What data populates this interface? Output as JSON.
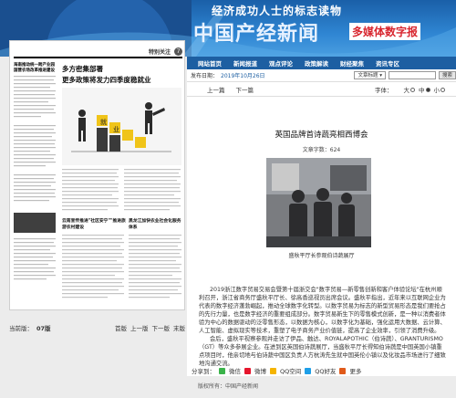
{
  "banner": {
    "slogan": "经济成功人士的标志读物",
    "brand": "中国产经新闻",
    "brand_sub": "多媒体数字报"
  },
  "nav": [
    "网站首页",
    "新闻报道",
    "观点评论",
    "政策解读",
    "财经聚焦",
    "资讯专区"
  ],
  "left_page": {
    "section": "特别关注",
    "page_no": "7",
    "headline_1": "多方密集部署",
    "headline_2": "更多政策将发力四季度稳就业",
    "side_title": "海南推动统一跨产业园国营农场改革推进建设",
    "sub_head_1": "云南宣传推进\"社区安宁\"\"推进旅游农村建设",
    "sub_head_2": "黑龙江加快农业社会化服务体系"
  },
  "page_info": {
    "label": "当前版：",
    "current": "07版",
    "first": "首版",
    "prev": "上一版",
    "next": "下一版",
    "last": "末版"
  },
  "toolbar": {
    "date_label": "发布日期：",
    "date_value": "2019年10月26日",
    "select_value": "文章标题",
    "search_btn": "搜索"
  },
  "pager": {
    "prev": "上一篇",
    "next": "下一篇",
    "font_label": "字体：",
    "big": "大",
    "mid": "中",
    "small": "小"
  },
  "article": {
    "title": "英国品牌首诗蔬亮相西博会",
    "count": "文章字数：624",
    "caption": "盛秋平厅长参观伯诗蔬展厅",
    "body": [
      "2019浙江数字贸易交易会暨第十届浙交会\"数字贸易—新零售创新和客户体验论坛\"在杭州顺利召开，浙江省商务厅盛秋平厅长、徐高香巡视员出席会议。盛秋平指出，近年来以互联网企业为代表的数字经济蓬勃崛起，推动全球数字化转型。以数字贸易为标志的新型贸易形态是我们要抢占的先行力量，也是数字经济的重要组成部分。数字贸易新生下的零售模式创新，是一种以消费者体验为中心的数据驱动的泛零售形态，以数据为核心，以数字化为基础，强化运用大数据、云计算、人工智能、虚拟现实等技术，重塑了电子商务产业价值链，提高了企业效率，引领了消费升级。",
      "会后，盛秋平视察参观并走访了伊品、触达、ROYALAPOTHIC（伯诗蔬）、GRANTURISMO（GT）等众多参展企业。在进到区英国伯诗蔬展厅，当盛秋平厅长得知伯诗蔬是中国英国小镇重点项目时，他亲切地与伯诗蔬中国区负责人方杭涛先生就中国英伦小镇以及化妆品市场进行了细致地沟通交流。"
    ]
  },
  "share": {
    "label": "分享到：",
    "items": [
      "微信",
      "微博",
      "QQ空间",
      "QQ好友",
      "更多"
    ]
  },
  "footer": "版权所有：中国产经新闻"
}
